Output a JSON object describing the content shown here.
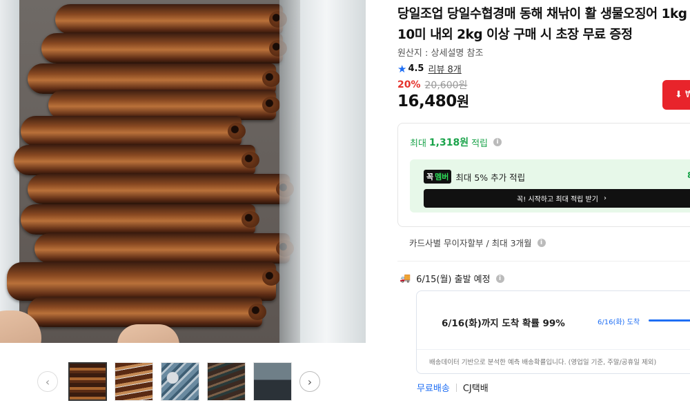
{
  "gallery": {
    "prev_icon": "chevron-left-icon",
    "next_icon": "chevron-right-icon",
    "prev_glyph": "‹",
    "next_glyph": "›",
    "thumbnail_count": 5,
    "active_index": 0
  },
  "product": {
    "title": "당일조업 당일수협경매 동해 채낚이 활 생물오징어 1kg 10미 내외 2kg 이상 구매 시 초장 무료 증정",
    "origin": "원산지 : 상세설명 참조",
    "rating": "4.5",
    "review": "리뷰 8개",
    "discount_rate": "20%",
    "original_price": "20,600원",
    "price": "16,480",
    "price_unit": "원",
    "download_icon": "download-icon",
    "download_glyph": "⬇ ₩"
  },
  "points": {
    "prefix": "최대",
    "amount": "1,318원",
    "suffix": "적립",
    "member_badge_left": "꼭",
    "member_badge_right": "멤버",
    "member_text": "최대 5% 추가 적립",
    "member_right": "8",
    "cta": "꼭! 시작하고 최대 적립 받기",
    "cta_arrow": "›"
  },
  "installment": {
    "text": "카드사별 무이자할부 / 최대 3개월"
  },
  "shipping": {
    "departure": "6/15(월) 출발 예정",
    "eta_main": "6/16(화)까지 도착 확률 99%",
    "eta_label": "6/16(화) 도착",
    "note": "배송데이터 기반으로 분석한 예측 배송확률입니다. (영업일 기준, 주말/공휴일 제외)",
    "free": "무료배송",
    "carrier": "CJ택배"
  },
  "colors": {
    "accent_red": "#e5322b",
    "points_green": "#1aa34a",
    "link_blue": "#1e6ef4"
  }
}
